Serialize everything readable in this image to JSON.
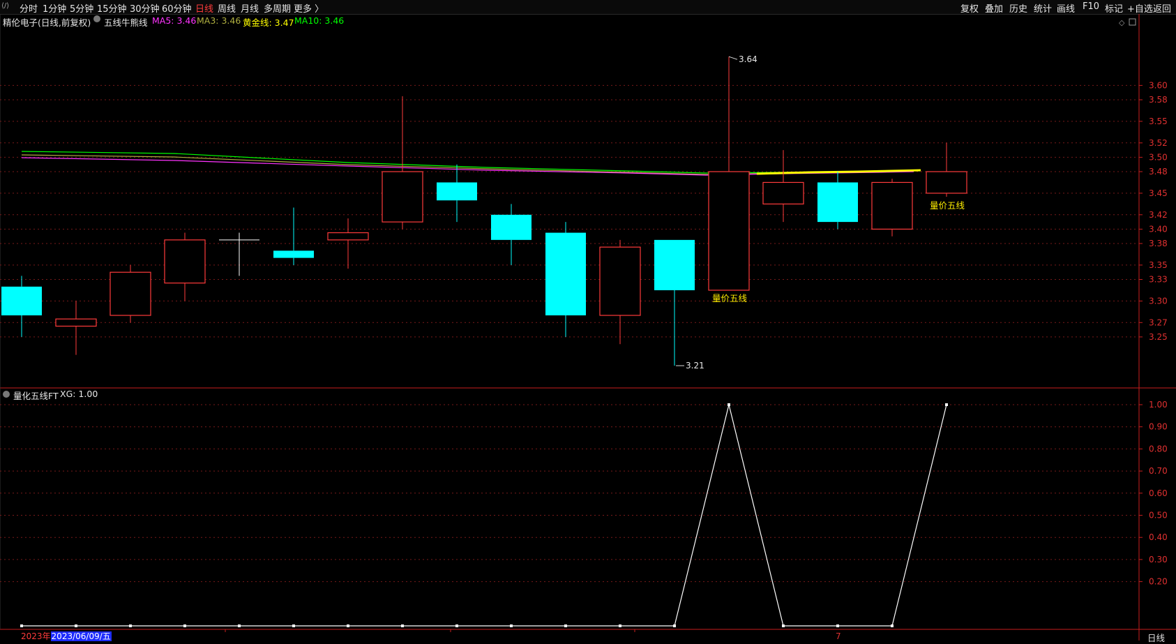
{
  "toolbar": {
    "left_tabs": [
      "分时",
      "1分钟",
      "5分钟",
      "15分钟",
      "30分钟",
      "60分钟",
      "日线",
      "周线",
      "月线",
      "多周期",
      "更多 〉"
    ],
    "active_tab": "日线",
    "right_tabs": [
      "复权",
      "叠加",
      "历史",
      "统计",
      "画线",
      "F10",
      "标记",
      "+自选",
      "返回"
    ]
  },
  "main_info": {
    "stock": "精伦电子(日线,前复权)",
    "indicator": "五线牛熊线",
    "ma5": "MA5: 3.46",
    "ma3": "MA3: 3.46",
    "gold": "黄金线: 3.47",
    "ma10": "MA10: 3.46"
  },
  "sub_info": {
    "indicator": "量化五线FT",
    "xg": "XG: 1.00"
  },
  "colors": {
    "up": "#ff3b3b",
    "down": "#00ffff",
    "ma5": "#ff33ff",
    "ma3": "#b0b040",
    "gold": "#ffff00",
    "ma10": "#00ff00",
    "axis": "#c81e1e"
  },
  "chart_data": [
    {
      "type": "candlestick",
      "y_ticks": [
        "3.60",
        "3.58",
        "3.55",
        "3.52",
        "3.50",
        "3.48",
        "3.45",
        "3.42",
        "3.40",
        "3.38",
        "3.35",
        "3.33",
        "3.30",
        "3.27",
        "3.25"
      ],
      "ylim": [
        3.18,
        3.68
      ],
      "candles": [
        {
          "o": 3.32,
          "c": 3.28,
          "h": 3.335,
          "l": 3.25
        },
        {
          "o": 3.265,
          "c": 3.275,
          "h": 3.3,
          "l": 3.225
        },
        {
          "o": 3.28,
          "c": 3.34,
          "h": 3.35,
          "l": 3.27
        },
        {
          "o": 3.325,
          "c": 3.385,
          "h": 3.395,
          "l": 3.3
        },
        {
          "o": 3.385,
          "c": 3.385,
          "h": 3.395,
          "l": 3.335
        },
        {
          "o": 3.37,
          "c": 3.36,
          "h": 3.43,
          "l": 3.35
        },
        {
          "o": 3.385,
          "c": 3.395,
          "h": 3.415,
          "l": 3.345
        },
        {
          "o": 3.41,
          "c": 3.48,
          "h": 3.585,
          "l": 3.4
        },
        {
          "o": 3.465,
          "c": 3.44,
          "h": 3.49,
          "l": 3.41
        },
        {
          "o": 3.42,
          "c": 3.385,
          "h": 3.435,
          "l": 3.35
        },
        {
          "o": 3.395,
          "c": 3.28,
          "h": 3.41,
          "l": 3.25
        },
        {
          "o": 3.28,
          "c": 3.375,
          "h": 3.385,
          "l": 3.24
        },
        {
          "o": 3.385,
          "c": 3.315,
          "h": 3.385,
          "l": 3.21
        },
        {
          "o": 3.315,
          "c": 3.48,
          "h": 3.64,
          "l": 3.315
        },
        {
          "o": 3.435,
          "c": 3.465,
          "h": 3.51,
          "l": 3.41
        },
        {
          "o": 3.465,
          "c": 3.41,
          "h": 3.48,
          "l": 3.4
        },
        {
          "o": 3.4,
          "c": 3.465,
          "h": 3.47,
          "l": 3.39
        },
        {
          "o": 3.45,
          "c": 3.48,
          "h": 3.52,
          "l": 3.445
        }
      ],
      "high_label": "3.64",
      "low_label": "3.21",
      "signal_label": "量价五线",
      "signal_indices": [
        13,
        17
      ]
    },
    {
      "type": "line",
      "y_ticks": [
        "1.00",
        "0.90",
        "0.80",
        "0.70",
        "0.60",
        "0.50",
        "0.40",
        "0.30",
        "0.20"
      ],
      "ylim": [
        0,
        1
      ],
      "values": [
        0,
        0,
        0,
        0,
        0,
        0,
        0,
        0,
        0,
        0,
        0,
        0,
        0,
        1,
        0,
        0,
        0,
        1
      ]
    }
  ],
  "x_axis": {
    "year": "2023年",
    "date": "2023/06/09/五",
    "month_tick": "7"
  },
  "period_label": "日线"
}
